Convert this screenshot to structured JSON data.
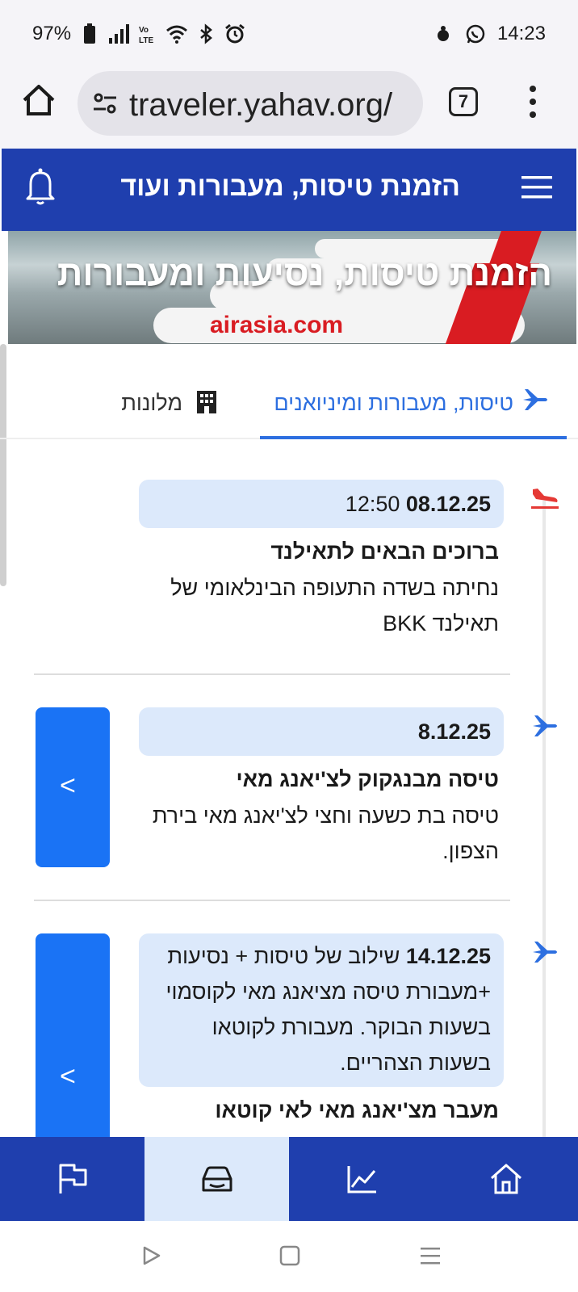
{
  "status_bar": {
    "battery": "97%",
    "time": "14:23",
    "icons_left": [
      "battery-icon",
      "signal-icon",
      "volte-icon",
      "wifi-icon",
      "bluetooth-icon",
      "alarm-icon"
    ],
    "icons_right": [
      "notification-icon",
      "whatsapp-icon"
    ]
  },
  "browser": {
    "url": "traveler.yahav.org/",
    "tab_count": "7"
  },
  "app_bar": {
    "title": "הזמנת טיסות, מעבורות ועוד"
  },
  "hero": {
    "heading": "הזמנת טיסות, נסיעות ומעבורות",
    "brand": "airasia.com"
  },
  "tabs": [
    {
      "label": "טיסות, מעבורות ומיניואנים",
      "icon": "airplane-icon",
      "active": true
    },
    {
      "label": "מלונות",
      "icon": "hotel-icon",
      "active": false
    }
  ],
  "timeline": [
    {
      "icon": "plane-landing-icon",
      "date": "08.12.25",
      "date_extra": "12:50",
      "title": "ברוכים הבאים לתאילנד",
      "description": "נחיתה בשדה התעופה הבינלאומי של תאילנד BKK"
    },
    {
      "icon": "airplane-icon",
      "date": "8.12.25",
      "date_extra": "",
      "title": "טיסה מבנגקוק לצ'יאנג מאי",
      "description": "טיסה בת כשעה וחצי לצ'יאנג מאי בירת הצפון."
    },
    {
      "icon": "airplane-icon",
      "date": "14.12.25",
      "date_extra": "שילוב של טיסות + נסיעות +מעבורת טיסה מציאנג מאי לקוסמוי בשעות הבוקר. מעבורת לקוטאו בשעות הצהריים.",
      "title": "מעבר מצ'יאנג מאי לאי קוטאו",
      "description": ""
    }
  ],
  "bottom_nav": [
    {
      "icon": "home-icon"
    },
    {
      "icon": "chart-icon"
    },
    {
      "icon": "car-icon",
      "active": true
    },
    {
      "icon": "flag-icon"
    }
  ],
  "colors": {
    "primary": "#1f3fae",
    "accent": "#2d6fe0",
    "button": "#1a73f5",
    "date_bg": "#dce9fb",
    "landing_icon": "#e53935"
  }
}
